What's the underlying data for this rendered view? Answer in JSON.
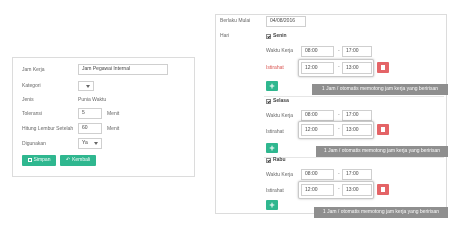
{
  "left_form": {
    "jam_kerja_label": "Jam Kerja",
    "jam_kerja_value": "Jam Pegawai Internal",
    "kategori_label": "Kategori",
    "kategori_value": "",
    "jenis_label": "Jenis",
    "jenis_value": "Punia Waktu",
    "toleransi_label": "Toleransi",
    "toleransi_value": "5",
    "toleransi_unit": "Menit",
    "lembur_label": "Hitung Lembur Setelah",
    "lembur_value": "60",
    "lembur_unit": "Menit",
    "digunakan_label": "Digunakan",
    "digunakan_value": "Ya",
    "simpan_label": "Simpan",
    "kembali_label": "Kembali"
  },
  "right_form": {
    "berlaku_label": "Berlaku Mulai",
    "berlaku_value": "04/08/2016",
    "hari_label": "Hari",
    "days": [
      {
        "name": "Senin",
        "waktu_kerja_label": "Waktu Kerja",
        "start": "08:00",
        "end": "17:00",
        "istirahat_label": "Istirahat",
        "break_start": "12:00",
        "break_end": "13:00",
        "tooltip": "1 Jam / otomatis memotong jam kerja yang beririsan"
      },
      {
        "name": "Selasa",
        "waktu_kerja_label": "Waktu Kerja",
        "start": "08:00",
        "end": "17:00",
        "istirahat_label": "Istirahat",
        "break_start": "12:00",
        "break_end": "13:00",
        "tooltip": "1 Jam / otomatis memotong jam kerja yang beririsan"
      },
      {
        "name": "Rabu",
        "waktu_kerja_label": "Waktu Kerja",
        "start": "08:00",
        "end": "17:00",
        "istirahat_label": "Istirahat",
        "break_start": "12:00",
        "break_end": "13:00",
        "tooltip": "1 Jam / otomatis memotong jam kerja yang beririsan"
      }
    ],
    "separator": "-"
  },
  "icons": {
    "save": "save-icon",
    "back": "undo-icon",
    "delete": "trash-icon",
    "add": "plus-icon"
  },
  "colors": {
    "green": "#2fb78f",
    "red": "#e46467",
    "tooltip_bg": "#8f8f8f",
    "istirahat_text": "#d9534f"
  }
}
